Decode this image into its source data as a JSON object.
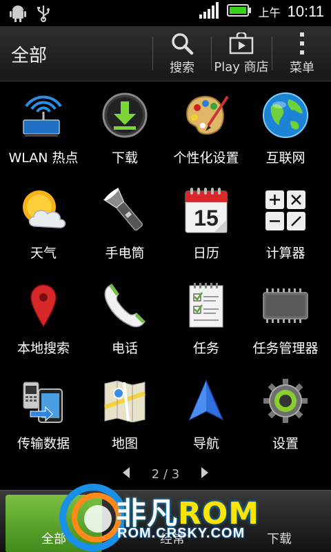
{
  "status": {
    "ampm": "上午",
    "time": "10:11",
    "icons": [
      "android-debug-icon",
      "usb-icon",
      "signal-icon",
      "battery-icon"
    ]
  },
  "header": {
    "title": "全部",
    "search_label": "搜索",
    "play_label": "Play 商店",
    "menu_label": "菜单"
  },
  "apps": [
    {
      "label": "WLAN 热点",
      "icon": "wlan-hotspot-icon"
    },
    {
      "label": "下载",
      "icon": "download-icon"
    },
    {
      "label": "个性化设置",
      "icon": "palette-icon"
    },
    {
      "label": "互联网",
      "icon": "globe-icon"
    },
    {
      "label": "天气",
      "icon": "weather-icon"
    },
    {
      "label": "手电筒",
      "icon": "flashlight-icon"
    },
    {
      "label": "日历",
      "icon": "calendar-icon",
      "calendar_day": "15"
    },
    {
      "label": "计算器",
      "icon": "calculator-icon"
    },
    {
      "label": "本地搜索",
      "icon": "map-pin-icon"
    },
    {
      "label": "电话",
      "icon": "phone-icon"
    },
    {
      "label": "任务",
      "icon": "tasks-icon"
    },
    {
      "label": "任务管理器",
      "icon": "chip-icon"
    },
    {
      "label": "传输数据",
      "icon": "transfer-icon"
    },
    {
      "label": "地图",
      "icon": "map-icon"
    },
    {
      "label": "导航",
      "icon": "navigation-icon"
    },
    {
      "label": "设置",
      "icon": "settings-gear-icon"
    }
  ],
  "pager": {
    "text": "2 / 3"
  },
  "bottom": {
    "tab1": "全部",
    "tab2_partial": "经常",
    "tab3_partial": "下载"
  },
  "watermark": {
    "brand_cn": "非凡",
    "brand_rom": "ROM",
    "url": "ROM.CRSKY.COM"
  },
  "colors": {
    "accent_green": "#7ac142",
    "background": "#000000"
  }
}
